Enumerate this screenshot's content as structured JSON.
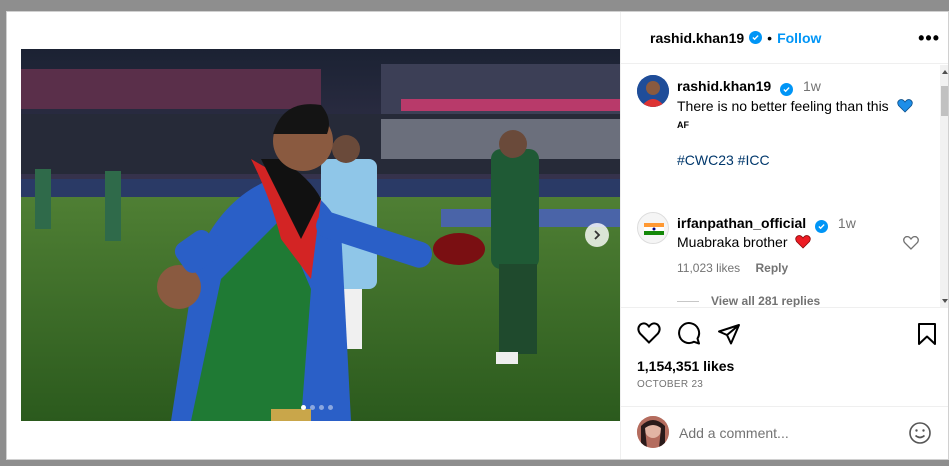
{
  "post": {
    "author": "rashid.khan19",
    "follow_label": "Follow",
    "separator": "•",
    "more_label": "•••",
    "carousel_dots": 4,
    "active_dot": 0
  },
  "caption": {
    "author": "rashid.khan19",
    "time": "1w",
    "text": "There is no better feeling than this",
    "flag_text": "AF",
    "hashtags": "#CWC23 #ICC"
  },
  "comment": {
    "author": "irfanpathan_official",
    "time": "1w",
    "text": "Muabraka brother",
    "likes": "11,023 likes",
    "reply_label": "Reply",
    "view_replies": "View all 281 replies"
  },
  "stats": {
    "likes": "1,154,351 likes",
    "date": "OCTOBER 23"
  },
  "composer": {
    "placeholder": "Add a comment..."
  },
  "colors": {
    "accent": "#0095f6",
    "hashtag": "#00376b",
    "muted": "#737373",
    "like_red": "#ed1c24",
    "heart_blue": "#1d8ee8"
  }
}
